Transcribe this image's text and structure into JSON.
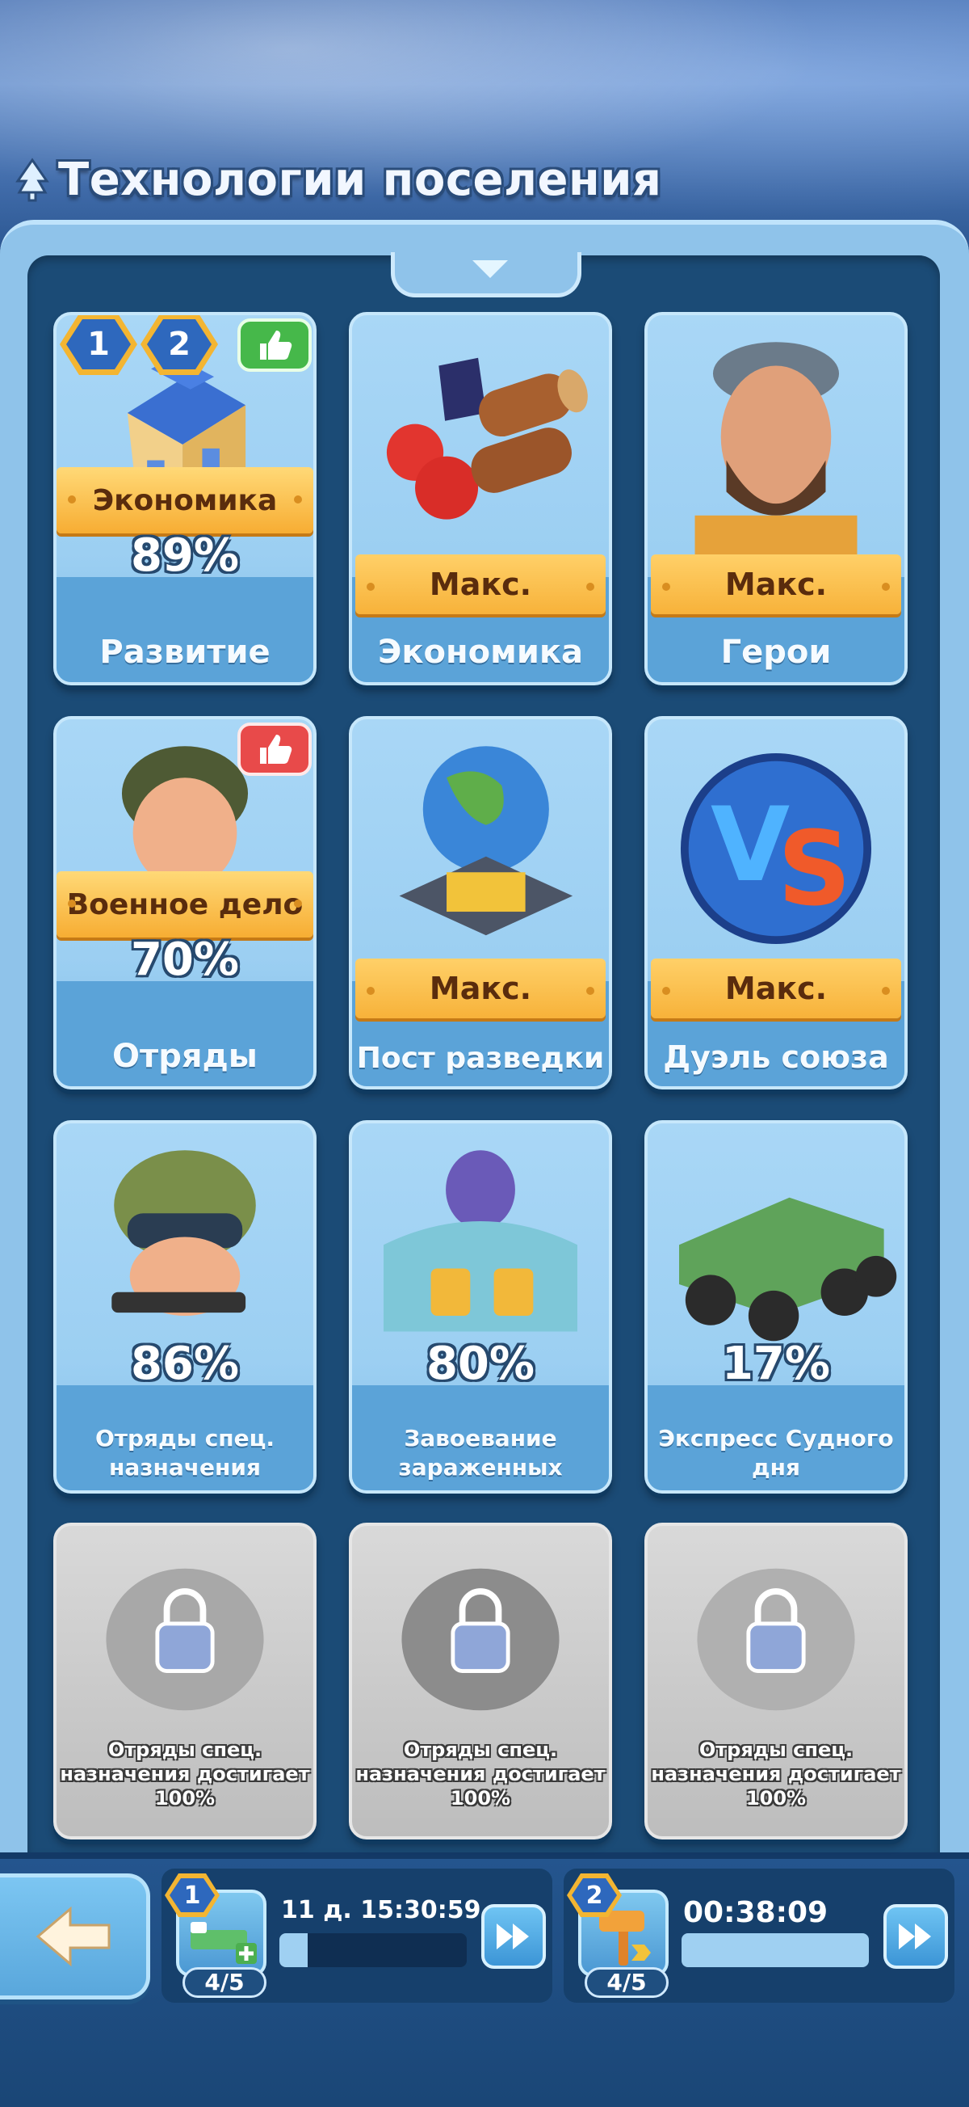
{
  "header": {
    "title": "Технологии поселения"
  },
  "cards": [
    {
      "label": "Развитие",
      "percent": "89%",
      "category": "Экономика",
      "badges": [
        "1",
        "2"
      ],
      "thumb": "green"
    },
    {
      "label": "Экономика",
      "max": "Макс."
    },
    {
      "label": "Герои",
      "max": "Макс."
    },
    {
      "label": "Отряды",
      "percent": "70%",
      "category": "Военное дело",
      "thumb": "red"
    },
    {
      "label": "Пост разведки",
      "max": "Макс."
    },
    {
      "label": "Дуэль союза",
      "max": "Макс."
    },
    {
      "label_line1": "Отряды спец.",
      "label_line2": "назначения",
      "percent": "86%"
    },
    {
      "label_line1": "Завоевание",
      "label_line2": "зараженных",
      "percent": "80%"
    },
    {
      "label_line1": "Экспресс Судного",
      "label_line2": "дня",
      "percent": "17%"
    }
  ],
  "locked": [
    {
      "line1": "Отряды спец.",
      "line2": "назначения достигает",
      "line3": "100%"
    },
    {
      "line1": "Отряды спец.",
      "line2": "назначения достигает",
      "line3": "100%"
    },
    {
      "line1": "Отряды спец.",
      "line2": "назначения достигает",
      "line3": "100%"
    }
  ],
  "queues": [
    {
      "badge": "1",
      "timer": "11 д. 15:30:59",
      "count": "4/5",
      "progress": 0.15,
      "icon": "hospital-bed-icon"
    },
    {
      "badge": "2",
      "timer": "00:38:09",
      "count": "4/5",
      "progress": 1.0,
      "icon": "hammer-icon"
    }
  ],
  "colors": {
    "accent": "#f7b23a",
    "panel": "#1b4b76",
    "card": "#9ccff2"
  }
}
